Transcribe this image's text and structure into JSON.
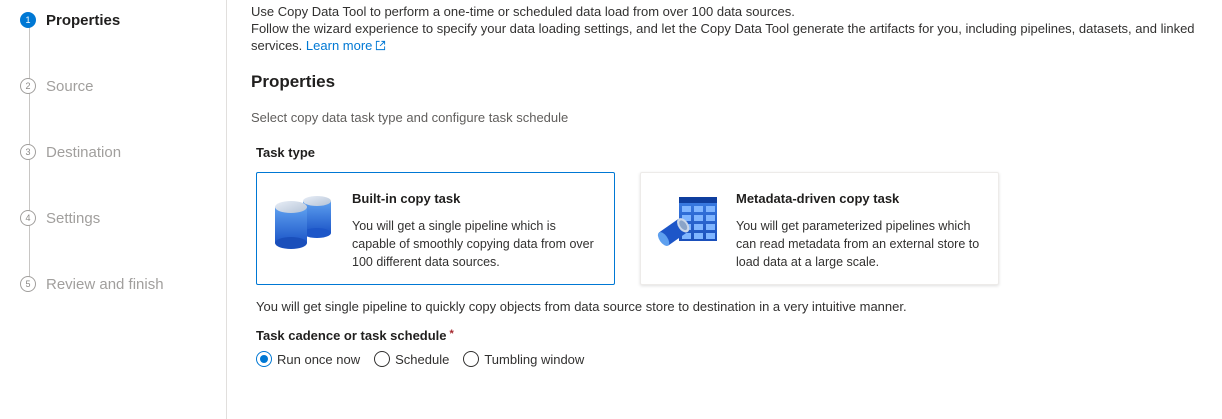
{
  "steps": [
    {
      "num": "1",
      "label": "Properties",
      "active": true
    },
    {
      "num": "2",
      "label": "Source",
      "active": false
    },
    {
      "num": "3",
      "label": "Destination",
      "active": false
    },
    {
      "num": "4",
      "label": "Settings",
      "active": false
    },
    {
      "num": "5",
      "label": "Review and finish",
      "active": false
    }
  ],
  "intro": {
    "line1": "Use Copy Data Tool to perform a one-time or scheduled data load from over 100 data sources.",
    "line2": "Follow the wizard experience to specify your data loading settings, and let the Copy Data Tool generate the artifacts for you, including pipelines, datasets, and linked services.",
    "learn_more": "Learn more"
  },
  "page_title": "Properties",
  "subtitle": "Select copy data task type and configure task schedule",
  "task_type_label": "Task type",
  "cards": [
    {
      "title": "Built-in copy task",
      "description": "You will get a single pipeline which is capable of smoothly copying data from over 100 different data sources.",
      "selected": true,
      "icon": "database-copy-icon"
    },
    {
      "title": "Metadata-driven copy task",
      "description": "You will get parameterized pipelines which can read metadata from an external store to load data at a large scale.",
      "selected": false,
      "icon": "metadata-table-icon"
    }
  ],
  "summary": "You will get single pipeline to quickly copy objects from data source store to destination in a very intuitive manner.",
  "cadence": {
    "label": "Task cadence or task schedule",
    "required_mark": "*",
    "options": [
      {
        "label": "Run once now",
        "checked": true
      },
      {
        "label": "Schedule",
        "checked": false
      },
      {
        "label": "Tumbling window",
        "checked": false
      }
    ]
  },
  "colors": {
    "accent": "#0078d4",
    "required": "#a4262c"
  }
}
